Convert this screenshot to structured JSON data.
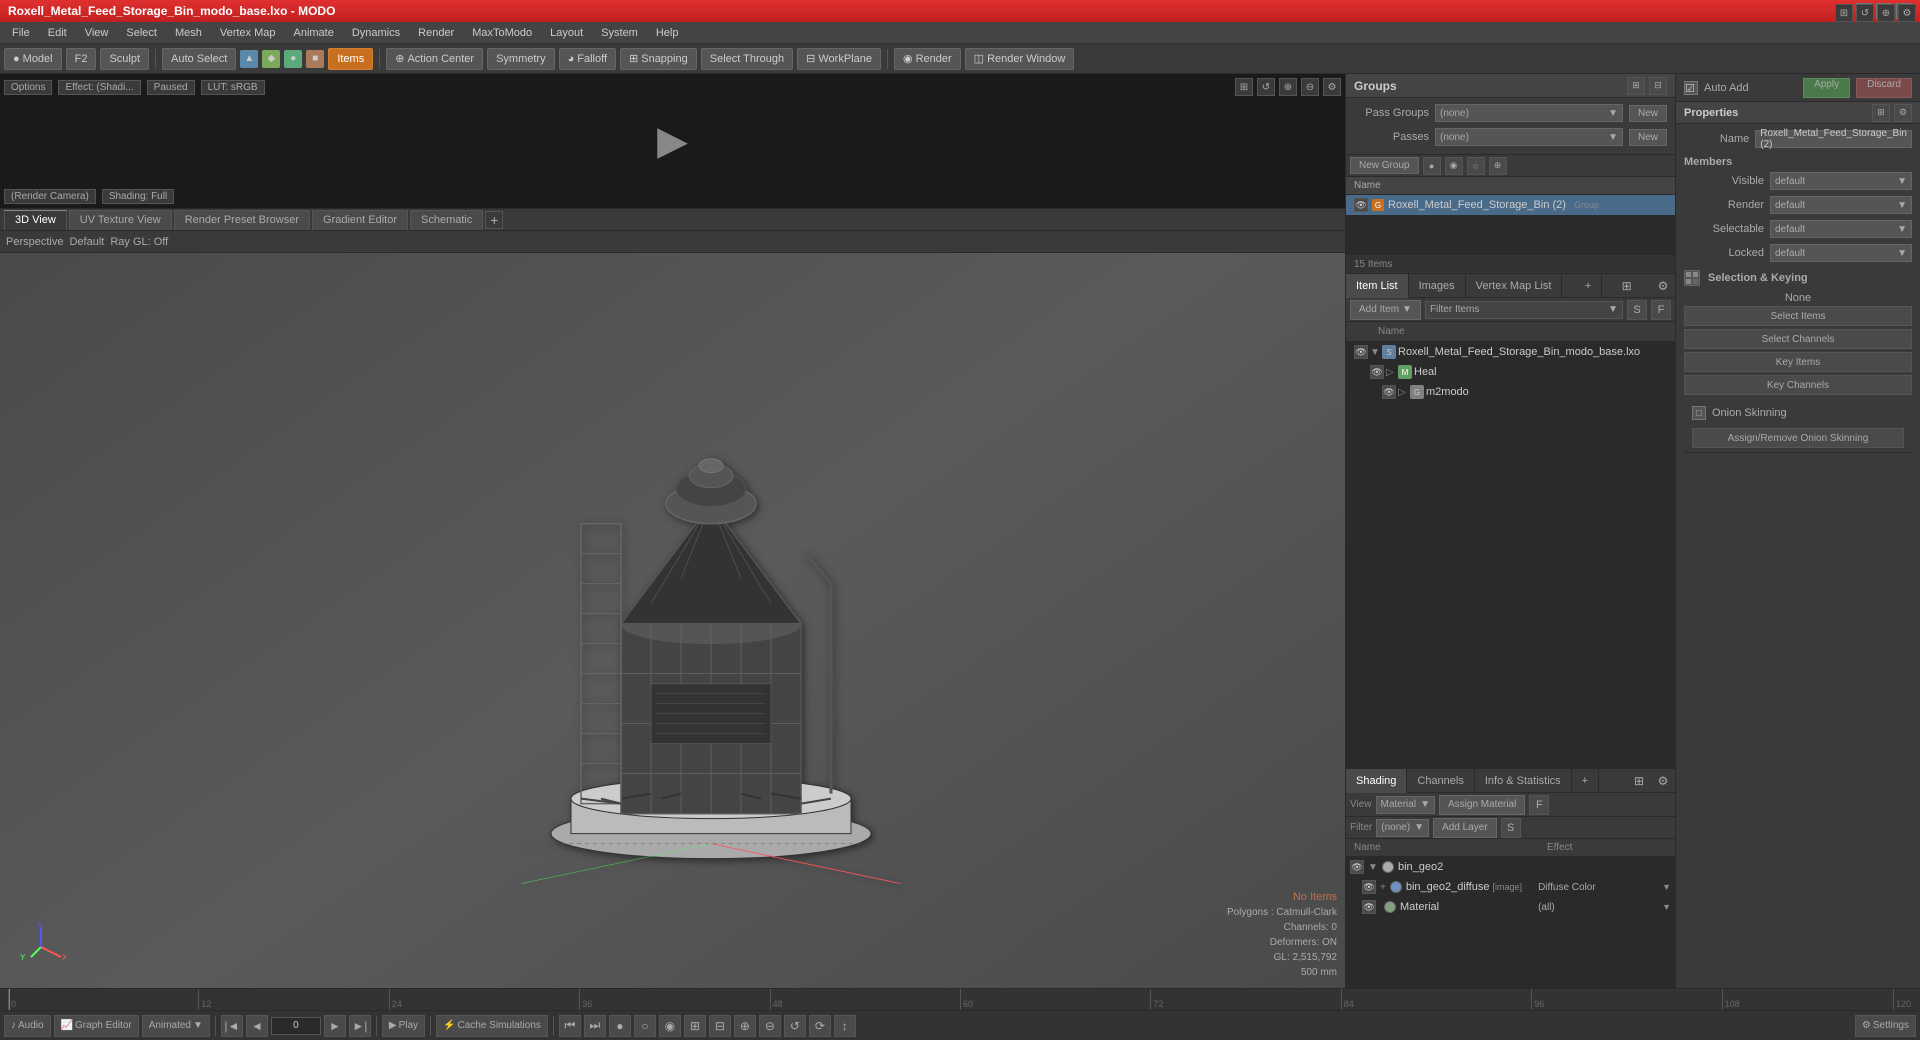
{
  "window": {
    "title": "Roxell_Metal_Feed_Storage_Bin_modo_base.lxo - MODO"
  },
  "title_bar": {
    "title": "Roxell_Metal_Feed_Storage_Bin_modo_base.lxo - MODO",
    "min": "—",
    "max": "□",
    "close": "✕"
  },
  "menu": {
    "items": [
      "File",
      "Edit",
      "View",
      "Select",
      "Mesh",
      "Vertex Map",
      "Animate",
      "Dynamics",
      "Render",
      "MaxToModo",
      "Layout",
      "System",
      "Help"
    ]
  },
  "toolbar": {
    "model_label": "Model",
    "f2_label": "F2",
    "sculpt_label": "Sculpt",
    "auto_select_label": "Auto Select",
    "items_label": "Items",
    "action_center_label": "Action Center",
    "symmetry_label": "Symmetry",
    "falloff_label": "Falloff",
    "snapping_label": "Snapping",
    "select_through_label": "Select Through",
    "workplane_label": "WorkPlane",
    "render_label": "Render",
    "render_window_label": "Render Window"
  },
  "preview": {
    "options_label": "Options",
    "effect_label": "Effect: (Shadi...",
    "paused_label": "Paused",
    "lut_label": "LUT: sRGB",
    "camera_label": "(Render Camera)",
    "shading_label": "Shading: Full",
    "play_icon": "▶"
  },
  "view_tabs": {
    "tabs": [
      "3D View",
      "UV Texture View",
      "Render Preset Browser",
      "Gradient Editor",
      "Schematic"
    ],
    "add_icon": "+"
  },
  "viewport": {
    "perspective_label": "Perspective",
    "default_label": "Default",
    "ray_gl_label": "Ray GL: Off",
    "stats": {
      "no_items": "No Items",
      "polygons": "Polygons : Catmull-Clark",
      "channels": "Channels: 0",
      "deformers": "Deformers: ON",
      "gl": "GL: 2,515,792",
      "size": "500 mm"
    }
  },
  "groups": {
    "title": "Groups",
    "new_group_label": "New Group",
    "pass_groups_label": "Pass Groups",
    "passes_label": "Passes",
    "pass_groups_value": "(none)",
    "passes_value": "(none)",
    "col_header": "Name",
    "items": [
      {
        "name": "Roxell_Metal_Feed_Storage_Bin (2)",
        "type": "group",
        "tag": "Group"
      }
    ],
    "item_count": "15 Items"
  },
  "auto_add": {
    "label": "Auto Add",
    "apply_label": "Apply",
    "discard_label": "Discard"
  },
  "properties": {
    "title": "Properties",
    "name_label": "Name",
    "name_value": "Roxell_Metal_Feed_Storage_Bin (2)",
    "members_label": "Members",
    "visible_label": "Visible",
    "visible_value": "default",
    "render_label": "Render",
    "render_value": "default",
    "selectable_label": "Selectable",
    "selectable_value": "default",
    "locked_label": "Locked",
    "locked_value": "default",
    "selection_keying_label": "Selection & Keying",
    "none_label": "None",
    "select_items_label": "Select Items",
    "select_channels_label": "Select Channels",
    "key_items_label": "Key Items",
    "key_channels_label": "Key Channels",
    "onion_skinning_label": "Onion Skinning",
    "assign_remove_label": "Assign/Remove Onion Skinning"
  },
  "item_list": {
    "tab_item_list": "Item List",
    "tab_images": "Images",
    "tab_vertex_map": "Vertex Map List",
    "tab_extra": "+",
    "add_item_label": "Add Item",
    "filter_items_label": "Filter Items",
    "col_name": "Name",
    "scene_file": "Roxell_Metal_Feed_Storage_Bin_modo_base.lxo",
    "items": [
      {
        "name": "Roxell_Metal_Feed_Storage_Bin_modo_base.lxo",
        "type": "scene",
        "level": 0,
        "expanded": true
      },
      {
        "name": "Heal",
        "type": "mesh",
        "level": 1,
        "expanded": false
      },
      {
        "name": "m2modo",
        "type": "group",
        "level": 2,
        "expanded": false
      }
    ]
  },
  "shading": {
    "tab_shading": "Shading",
    "tab_channels": "Channels",
    "tab_info": "Info & Statistics",
    "tab_extra": "+",
    "view_label": "View",
    "view_value": "Material",
    "assign_material_label": "Assign Material",
    "filter_label": "Filter",
    "filter_value": "(none)",
    "add_layer_label": "Add Layer",
    "col_name": "Name",
    "col_effect": "Effect",
    "items": [
      {
        "name": "bin_geo2",
        "type": "layer_group",
        "level": 0
      },
      {
        "name": "bin_geo2_diffuse",
        "tag": "[image]",
        "type": "image",
        "effect": "Diffuse Color",
        "level": 1
      },
      {
        "name": "Material",
        "type": "material",
        "effect": "(all)",
        "level": 1
      }
    ]
  },
  "timeline": {
    "marks": [
      "0",
      "12",
      "24",
      "36",
      "48",
      "60",
      "72",
      "84",
      "96",
      "108",
      "120"
    ],
    "start": "0",
    "end": "120",
    "current": "0"
  },
  "bottom_toolbar": {
    "audio_label": "Audio",
    "graph_editor_label": "Graph Editor",
    "animated_label": "Animated",
    "frame_input": "0",
    "play_label": "Play",
    "cache_simulations_label": "Cache Simulations",
    "settings_label": "Settings"
  }
}
